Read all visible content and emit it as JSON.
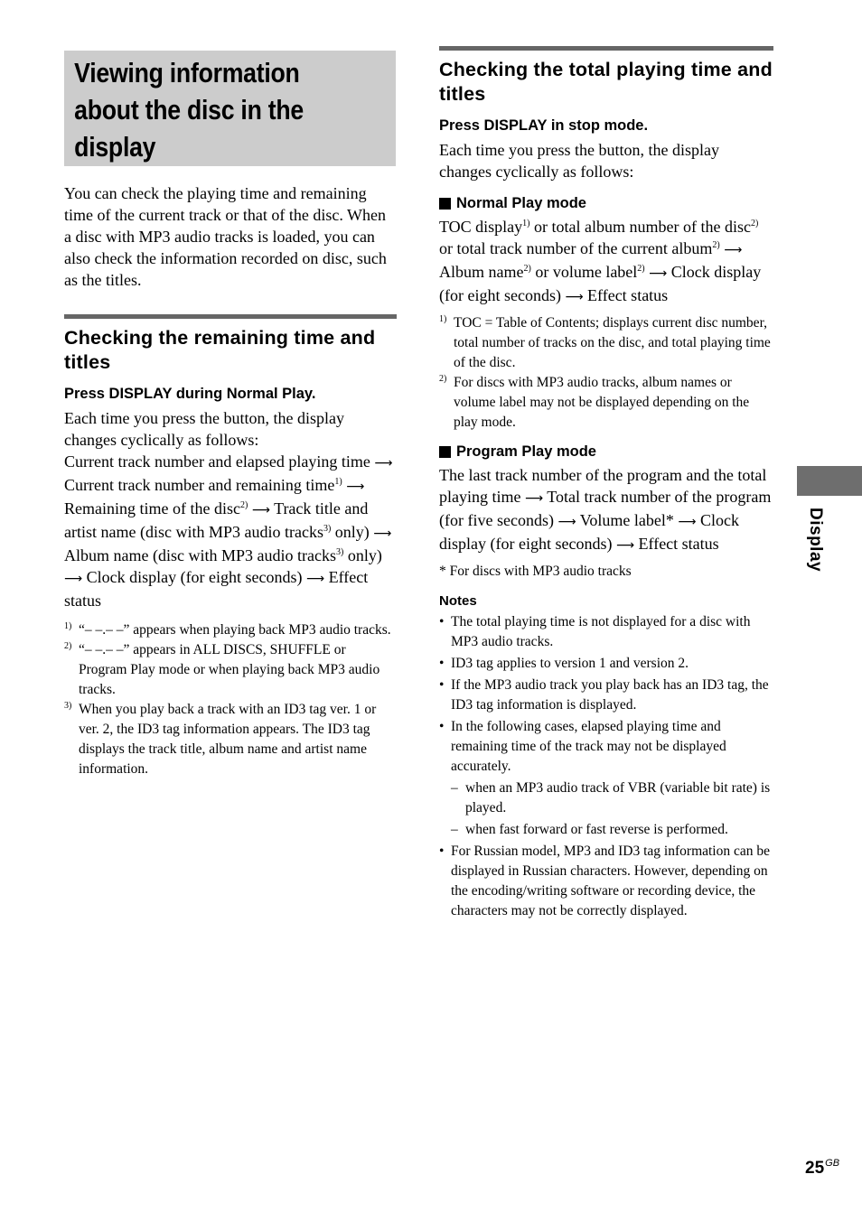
{
  "page_title": [
    "Viewing information",
    "about the disc in the",
    "display"
  ],
  "intro": "You can check the playing time and remaining time of the current track or that of the disc. When a disc with MP3 audio tracks is loaded, you can also check the information recorded on disc, such as the titles.",
  "remaining": {
    "title": "Checking the remaining time and titles",
    "instruction": "Press DISPLAY during Normal Play.",
    "lead": "Each time you press the button, the display changes cyclically as follows:",
    "seq": {
      "s1": "Current track number and elapsed playing time",
      "s2": "Current track number and remaining time",
      "s2_ref": "1)",
      "s3": "Remaining time of the disc",
      "s3_ref": "2)",
      "s4": "Track title and artist name (disc with MP3 audio tracks",
      "s4_ref": "3)",
      "s4_end": "only)",
      "s5": "Album name (disc with MP3 audio tracks",
      "s5_ref": "3)",
      "s5_end": "only)",
      "s6": "Clock display (for eight seconds)",
      "s7": "Effect status"
    },
    "footnotes": [
      {
        "mark": "1)",
        "text": "“– –.– –” appears when playing back MP3 audio tracks."
      },
      {
        "mark": "2)",
        "text": "“– –.– –” appears in ALL DISCS, SHUFFLE or Program Play mode or when playing back MP3 audio tracks."
      },
      {
        "mark": "3)",
        "text": "When you play back a track with an ID3 tag ver. 1 or ver. 2, the ID3 tag information appears. The ID3 tag displays the track title, album name and artist name information."
      }
    ]
  },
  "total": {
    "title": "Checking the total playing time and titles",
    "instruction": "Press DISPLAY in stop mode.",
    "lead": "Each time you press the button, the display changes cyclically as follows:",
    "normal": {
      "heading": "Normal Play mode",
      "a": "TOC display",
      "a_ref": "1)",
      "b": " or total album number of the disc",
      "b_ref": "2)",
      "c": " or total track number of the current album",
      "c_ref": "2)",
      "d": "Album name",
      "d_ref": "2)",
      "e": " or volume label",
      "e_ref": "2)",
      "f": "Clock display (for eight seconds)",
      "g": "Effect status"
    },
    "footnotes": [
      {
        "mark": "1)",
        "text": "TOC = Table of Contents; displays current disc number, total number of tracks on the disc, and total playing time of the disc."
      },
      {
        "mark": "2)",
        "text": "For discs with MP3 audio tracks, album names or volume label may not be displayed depending on the play mode."
      }
    ],
    "program": {
      "heading": "Program Play mode",
      "a": "The last track number of the program and the total playing time",
      "b": "Total track number of the program (for five seconds)",
      "c": "Volume label*",
      "d": "Clock display (for eight seconds)",
      "e": "Effect status",
      "asterisk_note": "* For discs with MP3 audio tracks"
    }
  },
  "notes": {
    "heading": "Notes",
    "items": [
      "The total playing time is not displayed for a disc with MP3 audio tracks.",
      "ID3 tag applies to version 1 and version 2.",
      "If the MP3 audio track you play back has an ID3 tag, the ID3 tag information is displayed.",
      "In the following cases, elapsed playing time and remaining time of the track may not be displayed accurately."
    ],
    "sub_items": [
      "when an MP3 audio track of VBR (variable bit rate) is played.",
      "when fast forward or fast reverse is performed."
    ],
    "last_item": "For Russian model, MP3 and ID3 tag information can be displayed in Russian characters. However, depending on the encoding/writing software or recording device, the characters may not be correctly displayed."
  },
  "side_tab_label": "Display",
  "page_number": "25",
  "page_suffix": "GB",
  "arrow_glyph": "⟶",
  "bullet_glyph": "•",
  "dash_glyph": "–",
  "colors": {
    "title_box": "#cccccc",
    "rule": "#666666",
    "side_tab": "#6e6e6e"
  }
}
